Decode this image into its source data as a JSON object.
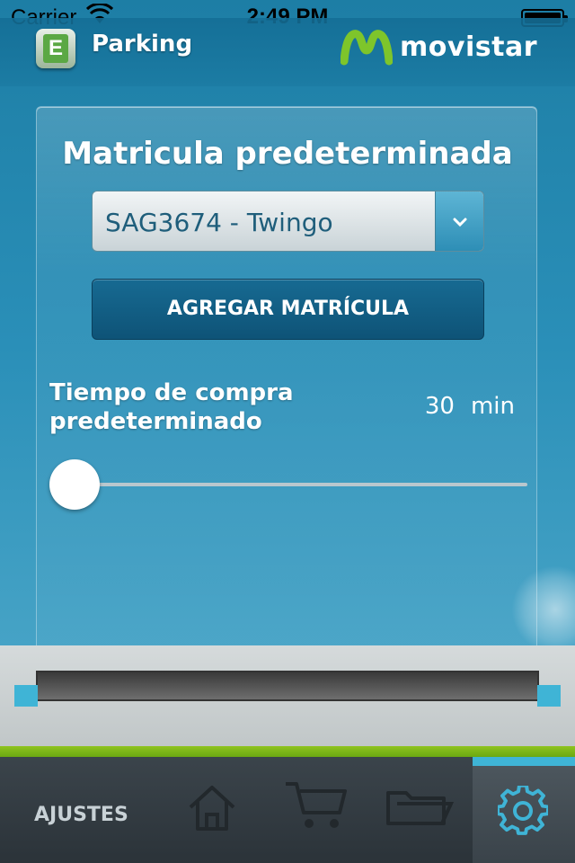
{
  "status_bar": {
    "carrier": "Carrier",
    "time": "2:49 PM",
    "wifi_icon": "wifi-icon",
    "battery_icon": "battery-icon"
  },
  "header": {
    "app_title": "Parking",
    "app_logo_letter": "E",
    "brand_name": "movistar"
  },
  "panel": {
    "title": "Matricula predeterminada",
    "selected_plate": "SAG3674 - Twingo",
    "add_button_label": "AGREGAR MATRÍCULA",
    "time_label": "Tiempo de compra predeterminado",
    "time_value": "30",
    "time_unit": "min",
    "slider_fraction": 0.0
  },
  "tabbar": {
    "section_label": "AJUSTES",
    "tabs": [
      {
        "icon": "home-icon"
      },
      {
        "icon": "cart-icon"
      },
      {
        "icon": "folder-icon"
      },
      {
        "icon": "gear-icon",
        "active": true
      }
    ]
  },
  "colors": {
    "accent": "#3fb4d6",
    "green_stripe": "#8fc31f",
    "button": "#176a92"
  }
}
